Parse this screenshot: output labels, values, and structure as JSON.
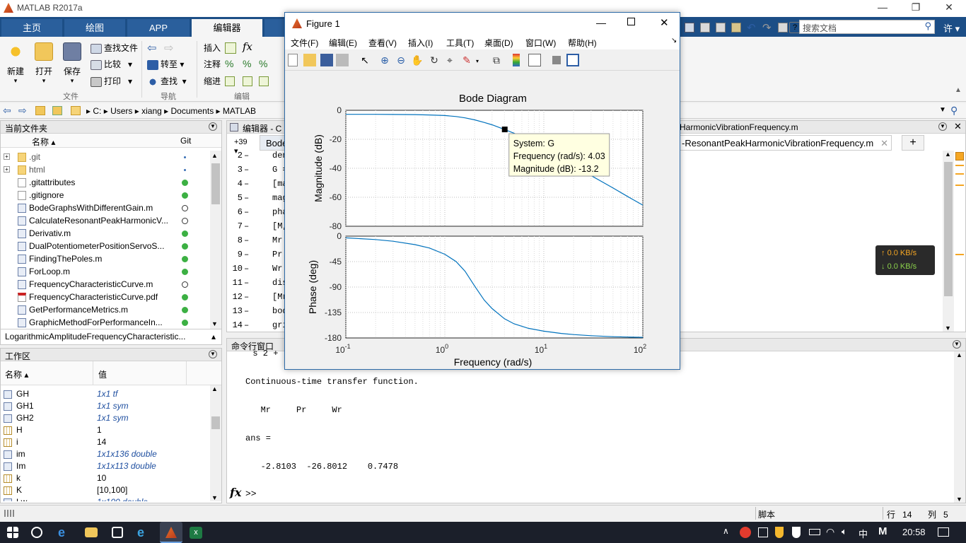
{
  "app": {
    "title": "MATLAB R2017a"
  },
  "ribbon": {
    "tabs": [
      "主页",
      "绘图",
      "APP",
      "编辑器"
    ],
    "new_label": "新建",
    "open_label": "打开",
    "save_label": "保存",
    "find_files": "查找文件",
    "compare": "比较",
    "print": "打印",
    "goto": "转至",
    "find": "查找",
    "insert": "插入",
    "comment": "注释",
    "indent": "缩进",
    "group_file": "文件",
    "group_nav": "导航",
    "group_edit": "编辑"
  },
  "search": {
    "placeholder": "搜索文档"
  },
  "user_label": "许",
  "address": {
    "crumbs": [
      "C:",
      "Users",
      "xiang",
      "Documents",
      "MATLAB"
    ]
  },
  "current_folder": {
    "title": "当前文件夹",
    "col_name": "名称",
    "col_git": "Git",
    "files": [
      {
        "name": ".git",
        "type": "folder",
        "status": "dot"
      },
      {
        "name": "html",
        "type": "folder",
        "status": "dot"
      },
      {
        "name": ".gitattributes",
        "type": "file",
        "status": "green"
      },
      {
        "name": ".gitignore",
        "type": "file",
        "status": "green"
      },
      {
        "name": "BodeGraphsWithDifferentGain.m",
        "type": "m",
        "status": "empty"
      },
      {
        "name": "CalculateResonantPeakHarmonicV...",
        "type": "m",
        "status": "empty"
      },
      {
        "name": "Derivativ.m",
        "type": "m",
        "status": "green"
      },
      {
        "name": "DualPotentiometerPositionServoS...",
        "type": "m",
        "status": "green"
      },
      {
        "name": "FindingThePoles.m",
        "type": "m",
        "status": "green"
      },
      {
        "name": "ForLoop.m",
        "type": "m",
        "status": "green"
      },
      {
        "name": "FrequencyCharacteristicCurve.m",
        "type": "m",
        "status": "empty"
      },
      {
        "name": "FrequencyCharacteristicCurve.pdf",
        "type": "pdf",
        "status": "green"
      },
      {
        "name": "GetPerformanceMetrics.m",
        "type": "m",
        "status": "green"
      },
      {
        "name": "GraphicMethodForPerformanceIn...",
        "type": "m",
        "status": "green"
      }
    ],
    "details": "LogarithmicAmplitudeFrequencyCharacteristic..."
  },
  "workspace": {
    "title": "工作区",
    "col_name": "名称",
    "col_value": "值",
    "vars": [
      {
        "name": "GH",
        "value": "1x1 tf",
        "italic": true
      },
      {
        "name": "GH1",
        "value": "1x1 sym",
        "italic": true
      },
      {
        "name": "GH2",
        "value": "1x1 sym",
        "italic": true
      },
      {
        "name": "H",
        "value": "1",
        "italic": false
      },
      {
        "name": "i",
        "value": "14",
        "italic": false
      },
      {
        "name": "im",
        "value": "1x1x136 double",
        "italic": true
      },
      {
        "name": "Im",
        "value": "1x1x113 double",
        "italic": true
      },
      {
        "name": "k",
        "value": "10",
        "italic": false
      },
      {
        "name": "K",
        "value": "[10,100]",
        "italic": false
      },
      {
        "name": "Lw",
        "value": "1x100 double",
        "italic": true
      }
    ]
  },
  "editor": {
    "title": "编辑器 - C",
    "tab_left": "Bode",
    "tab_right": "-ResonantPeakHarmonicVibrationFrequency.m",
    "title_right": "HarmonicVibrationFrequency.m",
    "breakpoint_label": "+39",
    "lines": [
      {
        "n": "2",
        "code": "den"
      },
      {
        "n": "3",
        "code": "G ="
      },
      {
        "n": "4",
        "code": "[ma"
      },
      {
        "n": "5",
        "code": "mag"
      },
      {
        "n": "6",
        "code": "pha"
      },
      {
        "n": "7",
        "code": "[M,"
      },
      {
        "n": "8",
        "code": "Mr"
      },
      {
        "n": "9",
        "code": "Pr"
      },
      {
        "n": "10",
        "code": "Wr"
      },
      {
        "n": "11",
        "code": "dis"
      },
      {
        "n": "12",
        "code": "[Mr"
      },
      {
        "n": "13",
        "code": "bod"
      },
      {
        "n": "14",
        "code": "gri"
      }
    ]
  },
  "command_window": {
    "title": "命令行窗口",
    "lines": [
      "  s 2 +",
      "Continuous-time transfer function.",
      "   Mr     Pr     Wr",
      "ans =",
      "   -2.8103  -26.8012    0.7478"
    ],
    "prompt": ">>",
    "fx": "fx"
  },
  "netmon": {
    "up": "0.0 KB/s",
    "down": "0.0 KB/s"
  },
  "status": {
    "mode": "脚本",
    "row_label": "行",
    "row": "14",
    "col_label": "列",
    "col": "5"
  },
  "taskbar": {
    "time": "20:58",
    "ime": "M"
  },
  "figure": {
    "title": "Figure 1",
    "menus": [
      "文件(F)",
      "编辑(E)",
      "查看(V)",
      "插入(I)",
      "工具(T)",
      "桌面(D)",
      "窗口(W)",
      "帮助(H)"
    ],
    "datatip": {
      "system": "System: G",
      "freq": "Frequency (rad/s): 4.03",
      "mag": "Magnitude (dB): -13.2"
    }
  },
  "chart_data": {
    "type": "line",
    "title": "Bode Diagram",
    "xlabel": "Frequency  (rad/s)",
    "xscale": "log",
    "xlim": [
      0.1,
      100
    ],
    "xticks": [
      "10-1",
      "100",
      "101",
      "102"
    ],
    "grid": true,
    "x": [
      0.1,
      0.2,
      0.3,
      0.5,
      0.7,
      1,
      1.3,
      1.6,
      2,
      2.5,
      3,
      4,
      5,
      7,
      10,
      15,
      20,
      30,
      50,
      70,
      100
    ],
    "panels": [
      {
        "ylabel": "Magnitude (dB)",
        "ylim": [
          -80,
          0
        ],
        "yticks": [
          "0",
          "-20",
          "-40",
          "-60",
          "-80"
        ],
        "values": [
          -2.8,
          -2.8,
          -2.9,
          -3.0,
          -3.2,
          -3.6,
          -4.3,
          -5.2,
          -6.6,
          -8.4,
          -10.0,
          -13.2,
          -15.8,
          -20.5,
          -26.4,
          -33.2,
          -38.2,
          -45.0,
          -53.6,
          -59.4,
          -65.4
        ]
      },
      {
        "ylabel": "Phase (deg)",
        "ylim": [
          -180,
          0
        ],
        "yticks": [
          "0",
          "-45",
          "-90",
          "-135",
          "-180"
        ],
        "values": [
          -3,
          -6,
          -9,
          -15,
          -21,
          -32,
          -45,
          -62,
          -88,
          -113,
          -128,
          -146,
          -155,
          -163,
          -168,
          -172,
          -174,
          -176,
          -177.7,
          -178.4,
          -178.9
        ]
      }
    ],
    "marker": {
      "x": 4.03,
      "y": -13.2
    }
  }
}
